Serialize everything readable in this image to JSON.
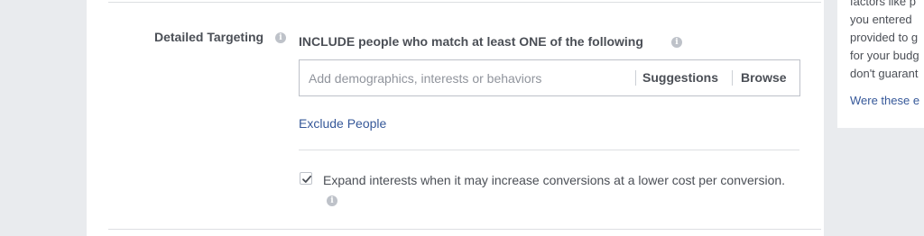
{
  "detailed_targeting": {
    "label": "Detailed Targeting",
    "include_text": "INCLUDE people who match at least ONE of the following",
    "search_placeholder": "Add demographics, interests or behaviors",
    "suggestions_label": "Suggestions",
    "browse_label": "Browse",
    "exclude_label": "Exclude People",
    "expand_checked": true,
    "expand_text": "Expand interests when it may increase conversions at a lower cost per conversion."
  },
  "side_panel": {
    "lines": [
      "factors like p",
      "you entered",
      "provided to g",
      "for your budg",
      "don't guarant"
    ],
    "link": "Were these e"
  },
  "icons": {
    "info": "info-icon",
    "check": "checkmark-icon"
  },
  "colors": {
    "background": "#e9ebee",
    "link": "#365899",
    "text": "#4b4f56"
  }
}
